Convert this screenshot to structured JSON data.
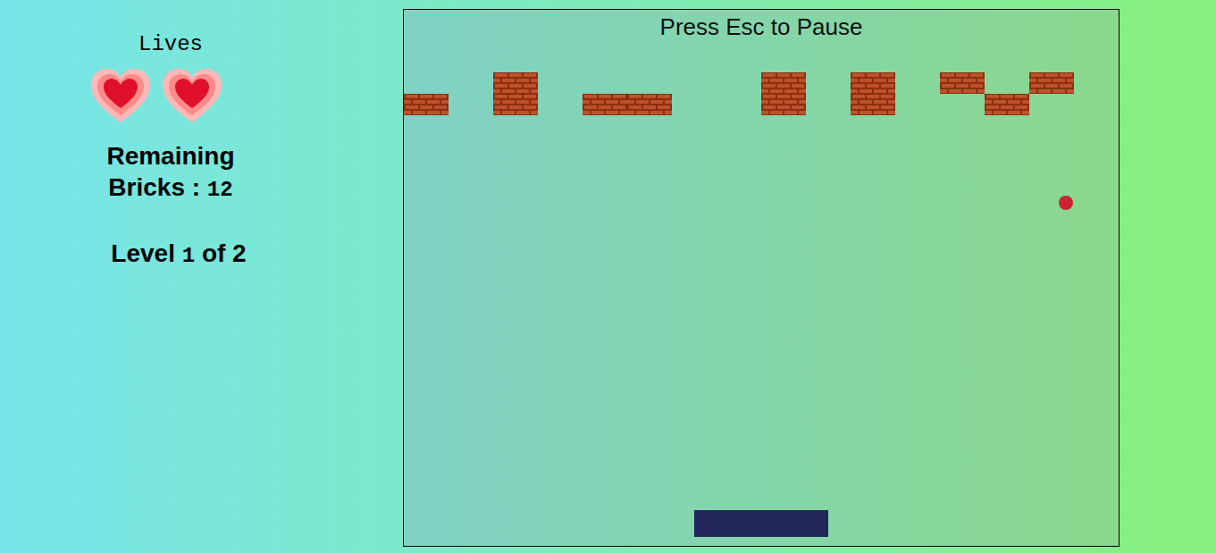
{
  "lives": {
    "label": "Lives",
    "count": 2
  },
  "remaining_bricks": {
    "label": "Remaining Bricks :",
    "value": "12"
  },
  "level": {
    "prefix": "Level",
    "current": "1",
    "separator": "of",
    "total": "2"
  },
  "game": {
    "hint": "Press Esc to Pause"
  }
}
